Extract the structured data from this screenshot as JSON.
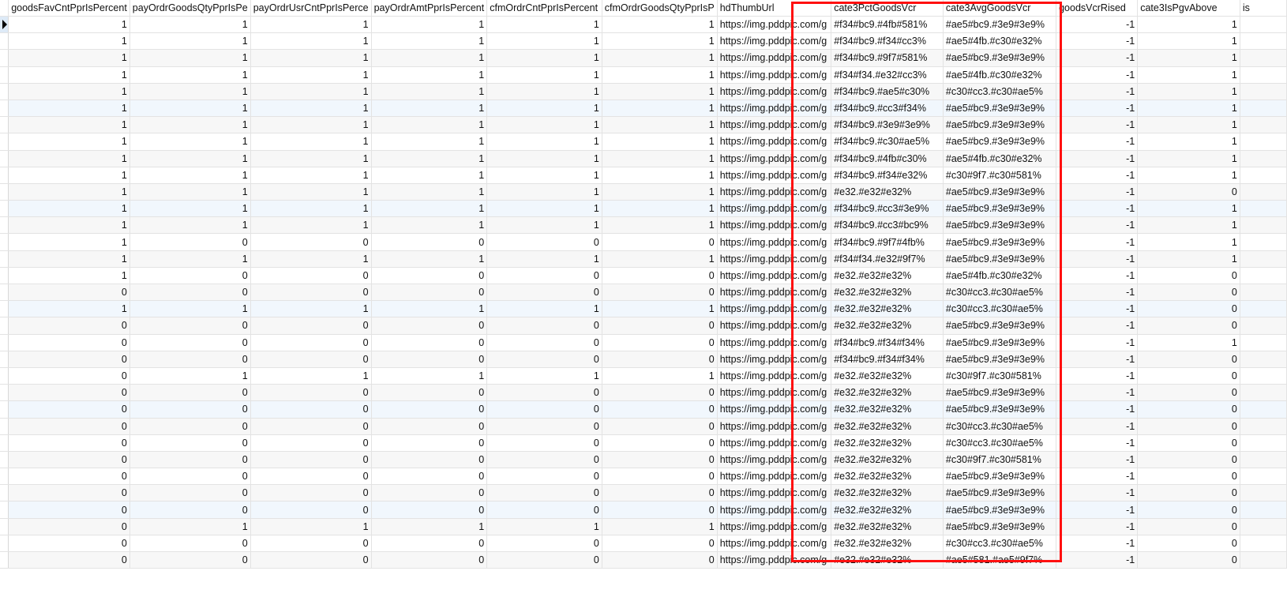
{
  "grid": {
    "columns": [
      "",
      "goodsFavCntPprIsPercent",
      "payOrdrGoodsQtyPprIsPe",
      "payOrdrUsrCntPprIsPerce",
      "payOrdrAmtPprIsPercent",
      "cfmOrdrCntPprIsPercent",
      "cfmOrdrGoodsQtyPprIsP",
      "hdThumbUrl",
      "cate3PctGoodsVcr",
      "cate3AvgGoodsVcr",
      "goodsVcrRised",
      "cate3IsPgvAbove",
      "is"
    ],
    "selected_row": 0,
    "rows": [
      [
        "1",
        "1",
        "1",
        "1",
        "1",
        "1",
        "https://img.pddpic.com/g",
        "#f34#bc9.#4fb#581%",
        "#ae5#bc9.#3e9#3e9%",
        "-1",
        "1"
      ],
      [
        "1",
        "1",
        "1",
        "1",
        "1",
        "1",
        "https://img.pddpic.com/g",
        "#f34#bc9.#f34#cc3%",
        "#ae5#4fb.#c30#e32%",
        "-1",
        "1"
      ],
      [
        "1",
        "1",
        "1",
        "1",
        "1",
        "1",
        "https://img.pddpic.com/g",
        "#f34#bc9.#9f7#581%",
        "#ae5#bc9.#3e9#3e9%",
        "-1",
        "1"
      ],
      [
        "1",
        "1",
        "1",
        "1",
        "1",
        "1",
        "https://img.pddpic.com/g",
        "#f34#f34.#e32#cc3%",
        "#ae5#4fb.#c30#e32%",
        "-1",
        "1"
      ],
      [
        "1",
        "1",
        "1",
        "1",
        "1",
        "1",
        "https://img.pddpic.com/g",
        "#f34#bc9.#ae5#c30%",
        "#c30#cc3.#c30#ae5%",
        "-1",
        "1"
      ],
      [
        "1",
        "1",
        "1",
        "1",
        "1",
        "1",
        "https://img.pddpic.com/g",
        "#f34#bc9.#cc3#f34%",
        "#ae5#bc9.#3e9#3e9%",
        "-1",
        "1"
      ],
      [
        "1",
        "1",
        "1",
        "1",
        "1",
        "1",
        "https://img.pddpic.com/g",
        "#f34#bc9.#3e9#3e9%",
        "#ae5#bc9.#3e9#3e9%",
        "-1",
        "1"
      ],
      [
        "1",
        "1",
        "1",
        "1",
        "1",
        "1",
        "https://img.pddpic.com/g",
        "#f34#bc9.#c30#ae5%",
        "#ae5#bc9.#3e9#3e9%",
        "-1",
        "1"
      ],
      [
        "1",
        "1",
        "1",
        "1",
        "1",
        "1",
        "https://img.pddpic.com/g",
        "#f34#bc9.#4fb#c30%",
        "#ae5#4fb.#c30#e32%",
        "-1",
        "1"
      ],
      [
        "1",
        "1",
        "1",
        "1",
        "1",
        "1",
        "https://img.pddpic.com/g",
        "#f34#bc9.#f34#e32%",
        "#c30#9f7.#c30#581%",
        "-1",
        "1"
      ],
      [
        "1",
        "1",
        "1",
        "1",
        "1",
        "1",
        "https://img.pddpic.com/g",
        "#e32.#e32#e32%",
        "#ae5#bc9.#3e9#3e9%",
        "-1",
        "0"
      ],
      [
        "1",
        "1",
        "1",
        "1",
        "1",
        "1",
        "https://img.pddpic.com/g",
        "#f34#bc9.#cc3#3e9%",
        "#ae5#bc9.#3e9#3e9%",
        "-1",
        "1"
      ],
      [
        "1",
        "1",
        "1",
        "1",
        "1",
        "1",
        "https://img.pddpic.com/g",
        "#f34#bc9.#cc3#bc9%",
        "#ae5#bc9.#3e9#3e9%",
        "-1",
        "1"
      ],
      [
        "1",
        "0",
        "0",
        "0",
        "0",
        "0",
        "https://img.pddpic.com/g",
        "#f34#bc9.#9f7#4fb%",
        "#ae5#bc9.#3e9#3e9%",
        "-1",
        "1"
      ],
      [
        "1",
        "1",
        "1",
        "1",
        "1",
        "1",
        "https://img.pddpic.com/g",
        "#f34#f34.#e32#9f7%",
        "#ae5#bc9.#3e9#3e9%",
        "-1",
        "1"
      ],
      [
        "1",
        "0",
        "0",
        "0",
        "0",
        "0",
        "https://img.pddpic.com/g",
        "#e32.#e32#e32%",
        "#ae5#4fb.#c30#e32%",
        "-1",
        "0"
      ],
      [
        "0",
        "0",
        "0",
        "0",
        "0",
        "0",
        "https://img.pddpic.com/g",
        "#e32.#e32#e32%",
        "#c30#cc3.#c30#ae5%",
        "-1",
        "0"
      ],
      [
        "1",
        "1",
        "1",
        "1",
        "1",
        "1",
        "https://img.pddpic.com/g",
        "#e32.#e32#e32%",
        "#c30#cc3.#c30#ae5%",
        "-1",
        "0"
      ],
      [
        "0",
        "0",
        "0",
        "0",
        "0",
        "0",
        "https://img.pddpic.com/g",
        "#e32.#e32#e32%",
        "#ae5#bc9.#3e9#3e9%",
        "-1",
        "0"
      ],
      [
        "0",
        "0",
        "0",
        "0",
        "0",
        "0",
        "https://img.pddpic.com/g",
        "#f34#bc9.#f34#f34%",
        "#ae5#bc9.#3e9#3e9%",
        "-1",
        "1"
      ],
      [
        "0",
        "0",
        "0",
        "0",
        "0",
        "0",
        "https://img.pddpic.com/g",
        "#f34#bc9.#f34#f34%",
        "#ae5#bc9.#3e9#3e9%",
        "-1",
        "0"
      ],
      [
        "0",
        "1",
        "1",
        "1",
        "1",
        "1",
        "https://img.pddpic.com/g",
        "#e32.#e32#e32%",
        "#c30#9f7.#c30#581%",
        "-1",
        "0"
      ],
      [
        "0",
        "0",
        "0",
        "0",
        "0",
        "0",
        "https://img.pddpic.com/g",
        "#e32.#e32#e32%",
        "#ae5#bc9.#3e9#3e9%",
        "-1",
        "0"
      ],
      [
        "0",
        "0",
        "0",
        "0",
        "0",
        "0",
        "https://img.pddpic.com/g",
        "#e32.#e32#e32%",
        "#ae5#bc9.#3e9#3e9%",
        "-1",
        "0"
      ],
      [
        "0",
        "0",
        "0",
        "0",
        "0",
        "0",
        "https://img.pddpic.com/g",
        "#e32.#e32#e32%",
        "#c30#cc3.#c30#ae5%",
        "-1",
        "0"
      ],
      [
        "0",
        "0",
        "0",
        "0",
        "0",
        "0",
        "https://img.pddpic.com/g",
        "#e32.#e32#e32%",
        "#c30#cc3.#c30#ae5%",
        "-1",
        "0"
      ],
      [
        "0",
        "0",
        "0",
        "0",
        "0",
        "0",
        "https://img.pddpic.com/g",
        "#e32.#e32#e32%",
        "#c30#9f7.#c30#581%",
        "-1",
        "0"
      ],
      [
        "0",
        "0",
        "0",
        "0",
        "0",
        "0",
        "https://img.pddpic.com/g",
        "#e32.#e32#e32%",
        "#ae5#bc9.#3e9#3e9%",
        "-1",
        "0"
      ],
      [
        "0",
        "0",
        "0",
        "0",
        "0",
        "0",
        "https://img.pddpic.com/g",
        "#e32.#e32#e32%",
        "#ae5#bc9.#3e9#3e9%",
        "-1",
        "0"
      ],
      [
        "0",
        "0",
        "0",
        "0",
        "0",
        "0",
        "https://img.pddpic.com/g",
        "#e32.#e32#e32%",
        "#ae5#bc9.#3e9#3e9%",
        "-1",
        "0"
      ],
      [
        "0",
        "1",
        "1",
        "1",
        "1",
        "1",
        "https://img.pddpic.com/g",
        "#e32.#e32#e32%",
        "#ae5#bc9.#3e9#3e9%",
        "-1",
        "0"
      ],
      [
        "0",
        "0",
        "0",
        "0",
        "0",
        "0",
        "https://img.pddpic.com/g",
        "#e32.#e32#e32%",
        "#c30#cc3.#c30#ae5%",
        "-1",
        "0"
      ],
      [
        "0",
        "0",
        "0",
        "0",
        "0",
        "0",
        "https://img.pddpic.com/g",
        "#e32.#e32#e32%",
        "#ae5#581.#ae5#9f7%",
        "-1",
        "0"
      ]
    ]
  },
  "highlight_color": "#ff1010"
}
